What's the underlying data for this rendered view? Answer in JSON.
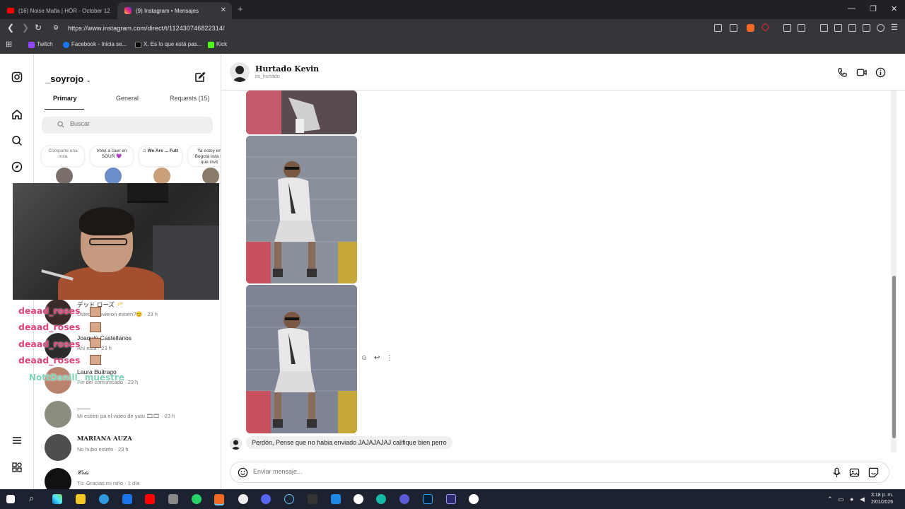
{
  "browser": {
    "tabs": [
      {
        "label": "(16) Noise Mafia | HÖR - October 12",
        "icon": "youtube-icon",
        "active": false
      },
      {
        "label": "(9) Instagram • Mensajes",
        "icon": "instagram-icon",
        "active": true
      }
    ],
    "url": "https://www.instagram.com/direct/t/112430746822314/",
    "bookmarks": [
      {
        "label": "Twitch",
        "icon": "twitch-icon",
        "color": "#9146ff"
      },
      {
        "label": "Facebook - Inicia se...",
        "icon": "facebook-icon",
        "color": "#1877f2"
      },
      {
        "label": "X. Es lo que está pas...",
        "icon": "x-icon",
        "color": "#000000"
      },
      {
        "label": "Kick",
        "icon": "kick-icon",
        "color": "#53fc18"
      }
    ]
  },
  "inbox": {
    "username": "_soyrojo",
    "tabs": [
      {
        "label": "Primary",
        "active": true
      },
      {
        "label": "General",
        "active": false
      },
      {
        "label": "Requests (15)",
        "active": false
      }
    ],
    "search_placeholder": "Buscar",
    "notes": [
      {
        "text": "Comparte una nota"
      },
      {
        "text": "Volví a caer en SOUR 💜"
      },
      {
        "text": "♫ We Are ... Futt"
      },
      {
        "text": "Ya estoy en Bogotá lista lo que invit"
      }
    ],
    "conversations": [
      {
        "name": "デッド ローズ 🥂",
        "preview": "Ustedes tuvieron estren?😊 · 23 h"
      },
      {
        "name": "Joaquín Castellanos",
        "preview": "Ahí está · 23 h"
      },
      {
        "name": "Laura Buitrago",
        "preview": "Fin del comunicado · 23 h"
      },
      {
        "name": "____",
        "preview": "Mi estren pa el video de yutu 🎞🎞 · 23 h"
      },
      {
        "name": "MARIANA AUZA",
        "preview": "No hubo estrén · 23 h"
      },
      {
        "name": "𝓒𝓻𝓲𝓼",
        "preview": "Tú: Gracias mi niño · 1 día"
      }
    ]
  },
  "stream_chat": {
    "lines": [
      "deaad_roses",
      "deaad_roses",
      "deaad_roses",
      "deaad_roses",
      "NottDanill_ muestre"
    ]
  },
  "conversation": {
    "peer_name": "Hurtado Kevin",
    "peer_handle": "its_hurtado",
    "last_message": "Perdón, Pense que no habia enviado JAJAJAJAJ califique bien perro",
    "composer_placeholder": "Enviar mensaje..."
  },
  "taskbar": {
    "time": "3:18 p. m.",
    "date": "2/01/2026"
  },
  "colors": {
    "accent": "#0095f6",
    "chat_name": "#e0447a"
  }
}
